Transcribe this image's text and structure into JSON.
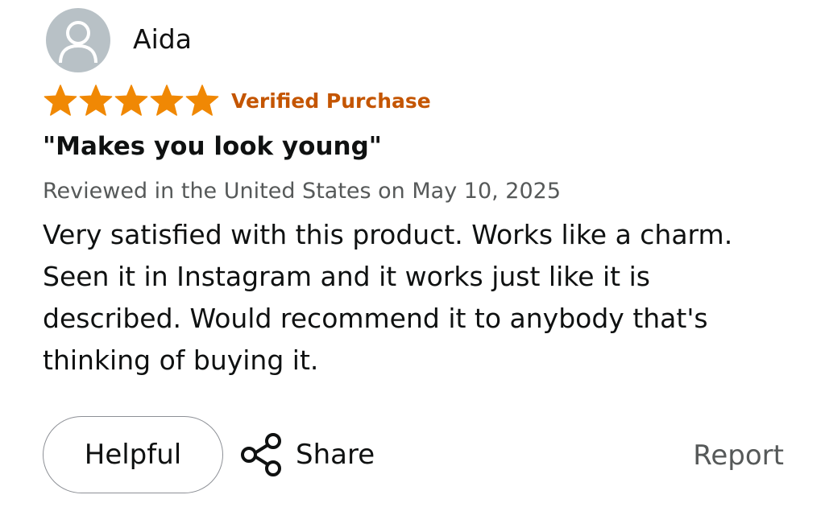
{
  "reviewer": {
    "name": "Aida",
    "avatar_icon": "user-silhouette-icon"
  },
  "rating": {
    "stars": 5,
    "max_stars": 5,
    "star_color": "#f08804",
    "verified_label": "Verified Purchase",
    "verified_color": "#c45500"
  },
  "review": {
    "title": "\"Makes you look young\"",
    "meta": "Reviewed in the United States on May 10, 2025",
    "body_lines": [
      "Very satisfied with this product. Works like a charm.",
      "Seen it in Instagram and it works just like it is",
      "described. Would recommend it to anybody that's",
      "thinking of buying it."
    ]
  },
  "actions": {
    "helpful_label": "Helpful",
    "share_label": "Share",
    "share_icon": "share-icon",
    "report_label": "Report"
  }
}
